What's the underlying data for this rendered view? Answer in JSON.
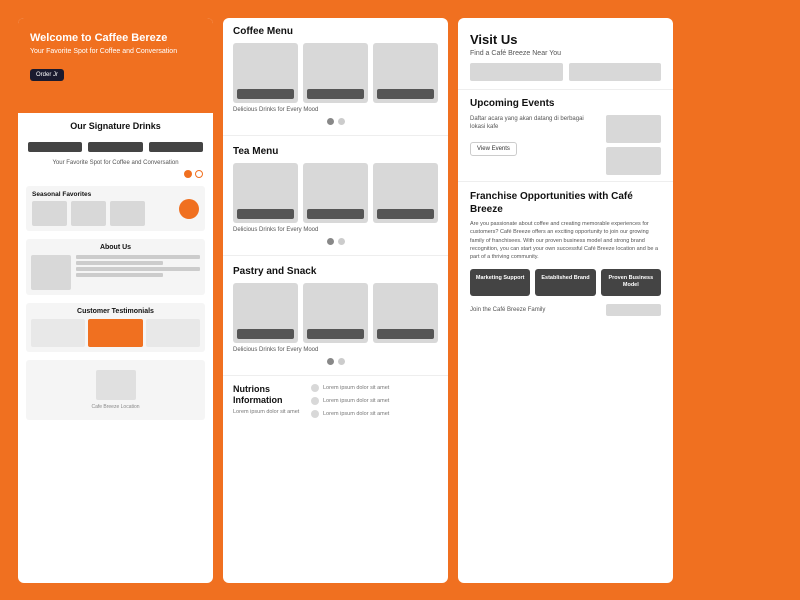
{
  "left": {
    "hero": {
      "title": "Welcome to Caffee Bereze",
      "subtitle": "Your Favorite Spot for Coffee and Conversation",
      "button": "Order Jr"
    },
    "signature": {
      "title": "Our Signature Drinks"
    },
    "footer_sub": "Your Favorite Spot for Coffee and Conversation",
    "seasonal": {
      "label": "Seasonal Favorites"
    },
    "about": {
      "title": "About Us"
    },
    "testimonials": {
      "title": "Customer Testimonials"
    }
  },
  "middle": {
    "sections": [
      {
        "title": "Coffee Menu",
        "caption": "Delicious Drinks for Every Mood"
      },
      {
        "title": "Tea Menu",
        "caption": "Delicious Drinks for Every Mood"
      },
      {
        "title": "Pastry and Snack",
        "caption": "Delicious Drinks for Every Mood"
      }
    ],
    "nutrition": {
      "title": "Nutrions Information",
      "subtitle": "Lorem ipsum dolor sit amet",
      "items": [
        "Lorem ipsum dolor sit amet",
        "Lorem ipsum dolor sit amet",
        "Lorem ipsum dolor sit amet"
      ]
    }
  },
  "right": {
    "visit": {
      "title": "Visit Us",
      "subtitle": "Find a Café Breeze Near You"
    },
    "events": {
      "title": "Upcoming Events",
      "description": "Daftar acara yang akan datang di berbagai lokasi kafe",
      "button": "View Events"
    },
    "franchise": {
      "title": "Franchise Opportunities with Café Breeze",
      "description": "Are you passionate about coffee and creating memorable experiences for customers? Café Breeze offers an exciting opportunity to join our growing family of franchisees. With our proven business model and strong brand recognition, you can start your own successful Café Breeze location and be a part of a thriving community.",
      "cards": [
        {
          "label": "Marketing Support"
        },
        {
          "label": "Established Brand"
        },
        {
          "label": "Proven Business Model"
        }
      ],
      "footer_text": "Join the Café Breeze Family"
    }
  }
}
